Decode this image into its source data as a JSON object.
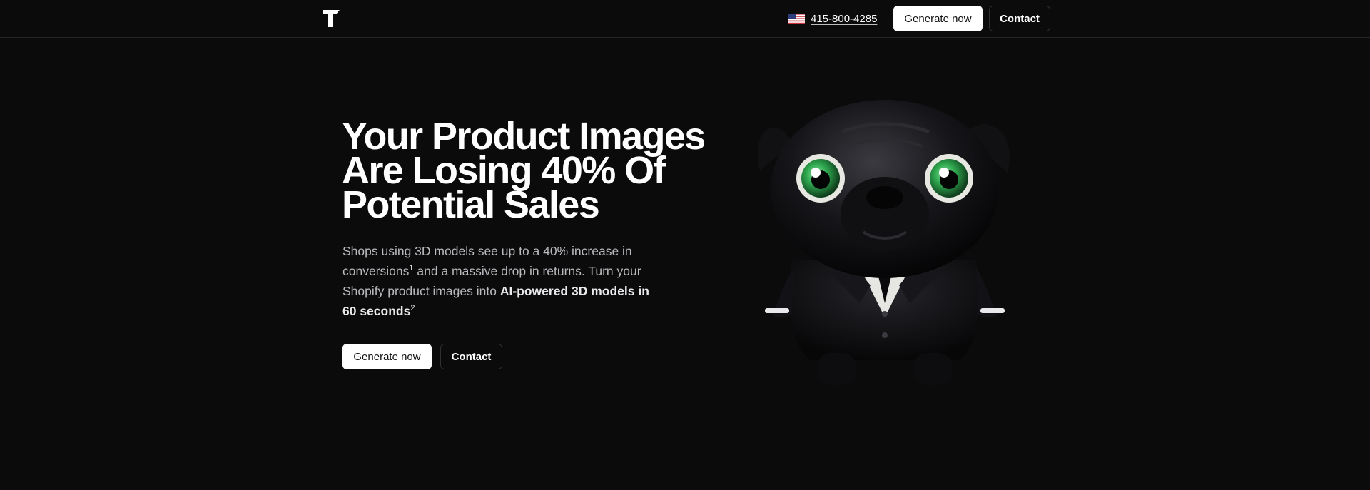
{
  "header": {
    "logo_icon": "brand-logo-icon",
    "flag_icon": "us-flag-icon",
    "phone": "415-800-4285",
    "generate_label": "Generate now",
    "contact_label": "Contact"
  },
  "hero": {
    "title": "Your Product Images Are Losing 40% Of Potential Sales",
    "subtitle": {
      "part1": "Shops using 3D models see up to a 40% increase in conversions",
      "footnote1": "1",
      "part2": " and a massive drop in returns. Turn your Shopify product images into ",
      "emphasis": "AI-powered 3D models in 60 seconds",
      "footnote2": "2"
    },
    "generate_label": "Generate now",
    "contact_label": "Contact",
    "image_icon": "pug-mascot-3d-image"
  },
  "colors": {
    "background": "#0b0b0c",
    "primary_button_bg": "#ffffff",
    "primary_button_text": "#111111",
    "border": "#26262a",
    "muted_text": "#b9b9be",
    "pug_eye": "#2fa84f"
  }
}
